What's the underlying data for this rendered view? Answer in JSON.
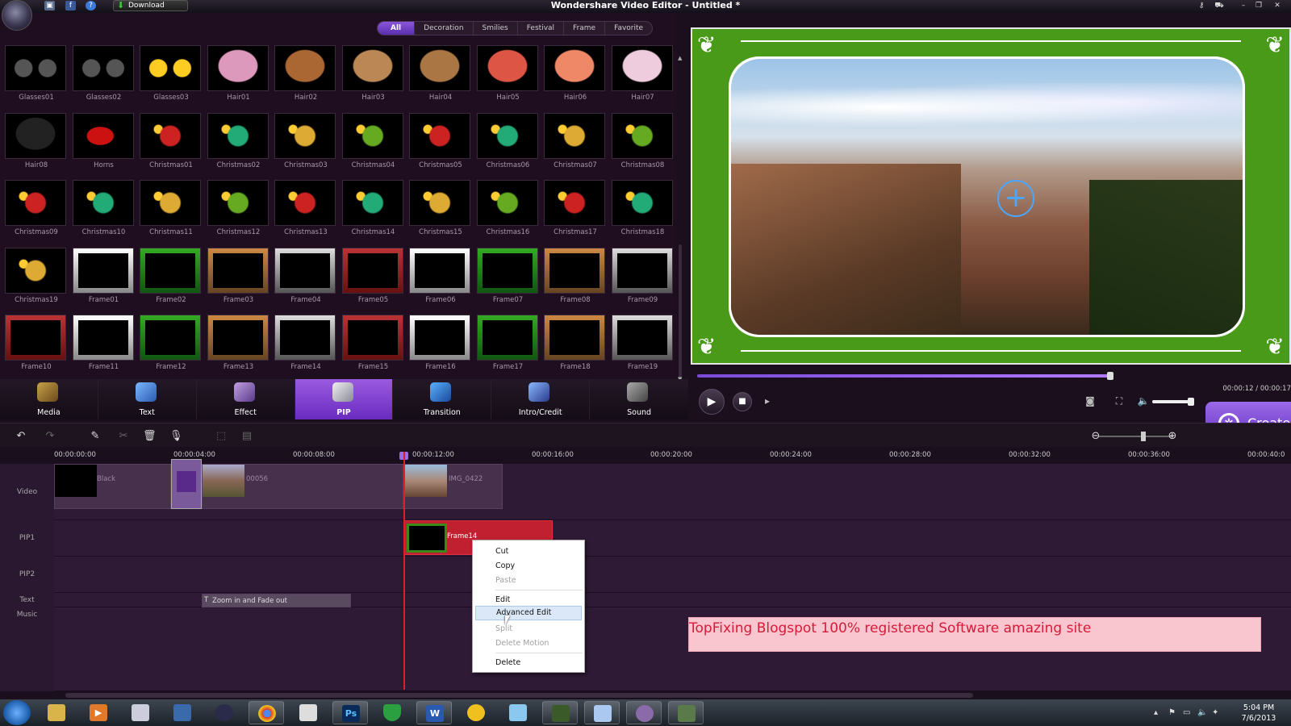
{
  "window": {
    "title": "Wondershare Video Editor - Untitled *",
    "download_label": "Download"
  },
  "library": {
    "tabs": [
      "All",
      "Decoration",
      "Smilies",
      "Festival",
      "Frame",
      "Favorite"
    ],
    "active_tab": "All",
    "items": [
      "Glasses01",
      "Glasses02",
      "Glasses03",
      "Hair01",
      "Hair02",
      "Hair03",
      "Hair04",
      "Hair05",
      "Hair06",
      "Hair07",
      "Hair08",
      "Horns",
      "Christmas01",
      "Christmas02",
      "Christmas03",
      "Christmas04",
      "Christmas05",
      "Christmas06",
      "Christmas07",
      "Christmas08",
      "Christmas09",
      "Christmas10",
      "Christmas11",
      "Christmas12",
      "Christmas13",
      "Christmas14",
      "Christmas15",
      "Christmas16",
      "Christmas17",
      "Christmas18",
      "Christmas19",
      "Frame01",
      "Frame02",
      "Frame03",
      "Frame04",
      "Frame05",
      "Frame06",
      "Frame07",
      "Frame08",
      "Frame09",
      "Frame10",
      "Frame11",
      "Frame12",
      "Frame13",
      "Frame14",
      "Frame15",
      "Frame16",
      "Frame17",
      "Frame18",
      "Frame19"
    ]
  },
  "toolbar": {
    "tools": [
      "Media",
      "Text",
      "Effect",
      "PIP",
      "Transition",
      "Intro/Credit",
      "Sound"
    ],
    "active": "PIP"
  },
  "player": {
    "timecode": "00:00:12 / 00:00:17",
    "progress": 1.0,
    "volume": 0.9,
    "create_label": "Create"
  },
  "timeline": {
    "ruler": [
      "00:00:00:00",
      "00:00:04:00",
      "00:00:08:00",
      "00:00:12:00",
      "00:00:16:00",
      "00:00:20:00",
      "00:00:24:00",
      "00:00:28:00",
      "00:00:32:00",
      "00:00:36:00",
      "00:00:40:0"
    ],
    "tracks": [
      "Video",
      "PIP1",
      "PIP2",
      "Text",
      "Music"
    ],
    "clips": {
      "black": "Black",
      "clip2": "00056",
      "clip3": "IMG_0422",
      "pip": "Frame14",
      "text": "Zoom in and Fade out"
    }
  },
  "context_menu": {
    "cut": "Cut",
    "copy": "Copy",
    "paste": "Paste",
    "edit": "Edit",
    "advanced_edit": "Advanced Edit",
    "split": "Split",
    "delete_motion": "Delete Motion",
    "delete": "Delete"
  },
  "banner": {
    "text": "TopFixing Blogspot 100% registered Software amazing site"
  },
  "taskbar": {
    "time": "5:04 PM",
    "date": "7/6/2013",
    "ps_label": "Ps",
    "word_label": "W"
  },
  "colors": {
    "accent": "#7a44d0",
    "frame_green": "#4a9a1a",
    "playhead": "#e02020",
    "banner_text": "#d61a3a",
    "banner_bg": "#f9c6cf"
  }
}
